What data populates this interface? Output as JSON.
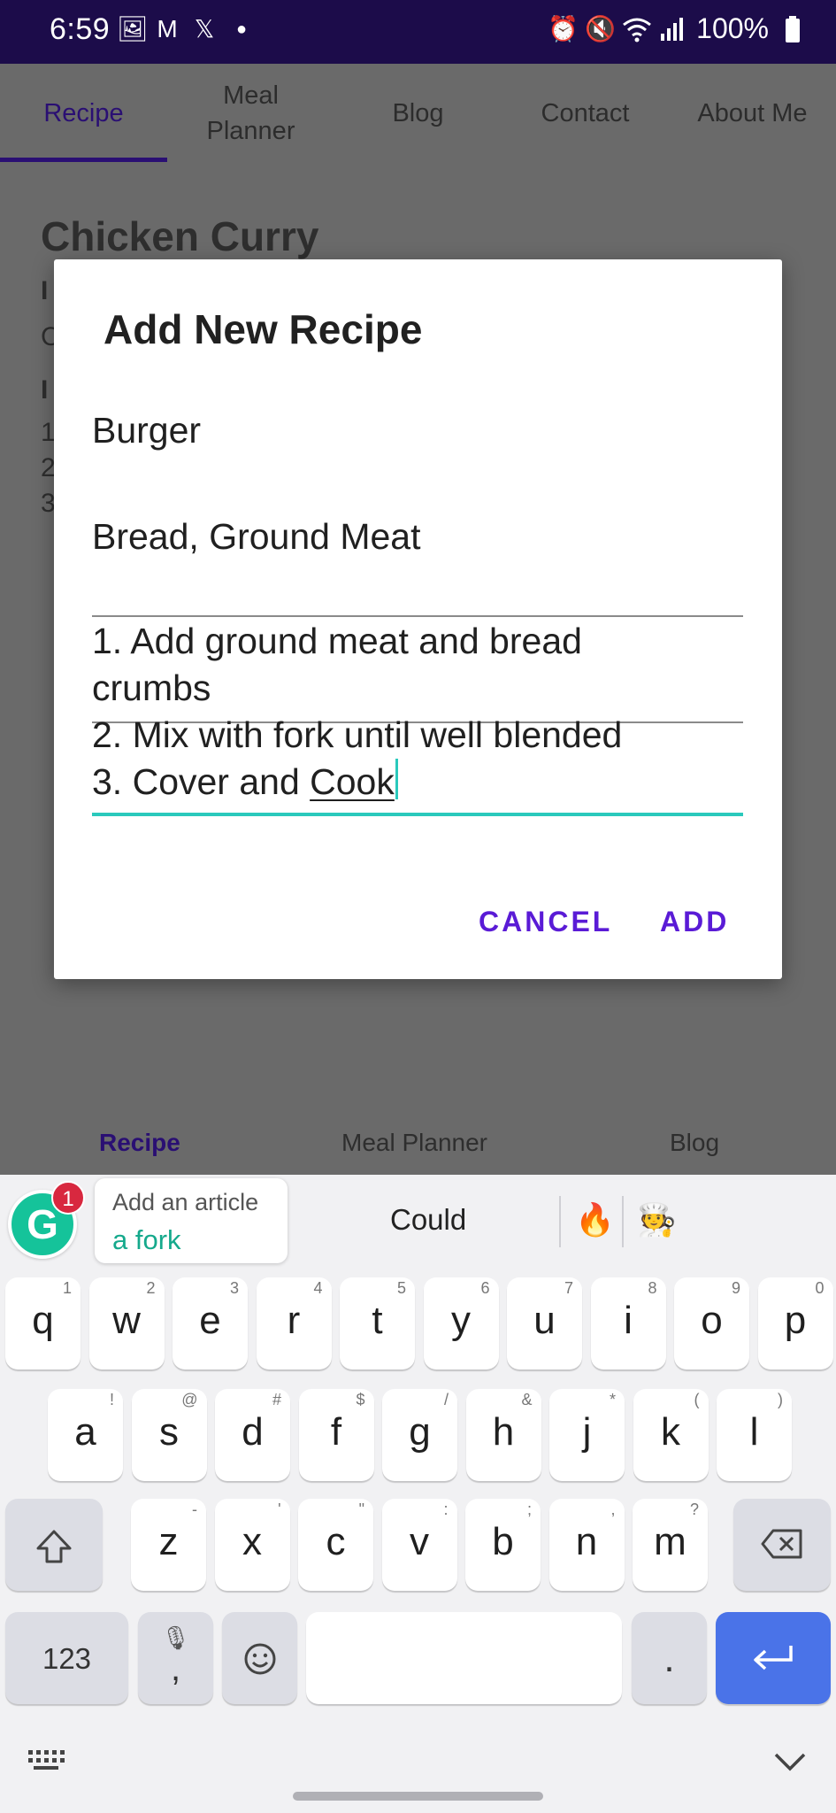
{
  "status_bar": {
    "time": "6:59",
    "battery": "100%"
  },
  "tabs": [
    {
      "label": "Recipe",
      "active": true
    },
    {
      "label": "Meal Planner",
      "active": false
    },
    {
      "label": "Blog",
      "active": false
    },
    {
      "label": "Contact",
      "active": false
    },
    {
      "label": "About Me",
      "active": false
    }
  ],
  "background": {
    "recipe_title": "Chicken Curry",
    "fragments": [
      "I",
      "C",
      "I",
      "1",
      "2",
      "3"
    ]
  },
  "dialog": {
    "title": "Add New Recipe",
    "name_value": "Burger",
    "ingredients_value": "Bread, Ground Meat",
    "steps_value_lines": [
      "1. Add ground meat and bread",
      "crumbs",
      "2. Mix with fork until well blended",
      "3. Cover and "
    ],
    "steps_last_word": "Cook",
    "cancel_label": "CANCEL",
    "add_label": "ADD"
  },
  "bottom_nav": [
    {
      "label": "Recipe",
      "active": true
    },
    {
      "label": "Meal Planner",
      "active": false
    },
    {
      "label": "Blog",
      "active": false
    }
  ],
  "keyboard": {
    "grammarly_badge": "1",
    "grammarly_logo": "G",
    "grammarly_hint": "Add an article",
    "grammarly_suggestion": "a fork",
    "suggestion_word": "Could",
    "emojis": [
      "🔥",
      "🧑‍🍳"
    ],
    "row1": [
      {
        "k": "q",
        "s": "1"
      },
      {
        "k": "w",
        "s": "2"
      },
      {
        "k": "e",
        "s": "3"
      },
      {
        "k": "r",
        "s": "4"
      },
      {
        "k": "t",
        "s": "5"
      },
      {
        "k": "y",
        "s": "6"
      },
      {
        "k": "u",
        "s": "7"
      },
      {
        "k": "i",
        "s": "8"
      },
      {
        "k": "o",
        "s": "9"
      },
      {
        "k": "p",
        "s": "0"
      }
    ],
    "row2": [
      {
        "k": "a",
        "s": "!"
      },
      {
        "k": "s",
        "s": "@"
      },
      {
        "k": "d",
        "s": "#"
      },
      {
        "k": "f",
        "s": "$"
      },
      {
        "k": "g",
        "s": "/"
      },
      {
        "k": "h",
        "s": "&"
      },
      {
        "k": "j",
        "s": "*"
      },
      {
        "k": "k",
        "s": "("
      },
      {
        "k": "l",
        "s": ")"
      }
    ],
    "row3": [
      {
        "k": "z",
        "s": "-"
      },
      {
        "k": "x",
        "s": "'"
      },
      {
        "k": "c",
        "s": "\""
      },
      {
        "k": "v",
        "s": ":"
      },
      {
        "k": "b",
        "s": ";"
      },
      {
        "k": "n",
        "s": ","
      },
      {
        "k": "m",
        "s": "?"
      }
    ],
    "numbers_label": "123",
    "period_label": ".",
    "comma_label": ","
  },
  "colors": {
    "status_bar": "#1c0c4a",
    "accent_purple": "#5a1bd6",
    "tab_active": "#2a0f73",
    "focus_teal": "#2ac9bc",
    "enter_key": "#4a73e8",
    "grammarly_green": "#15c39a"
  }
}
